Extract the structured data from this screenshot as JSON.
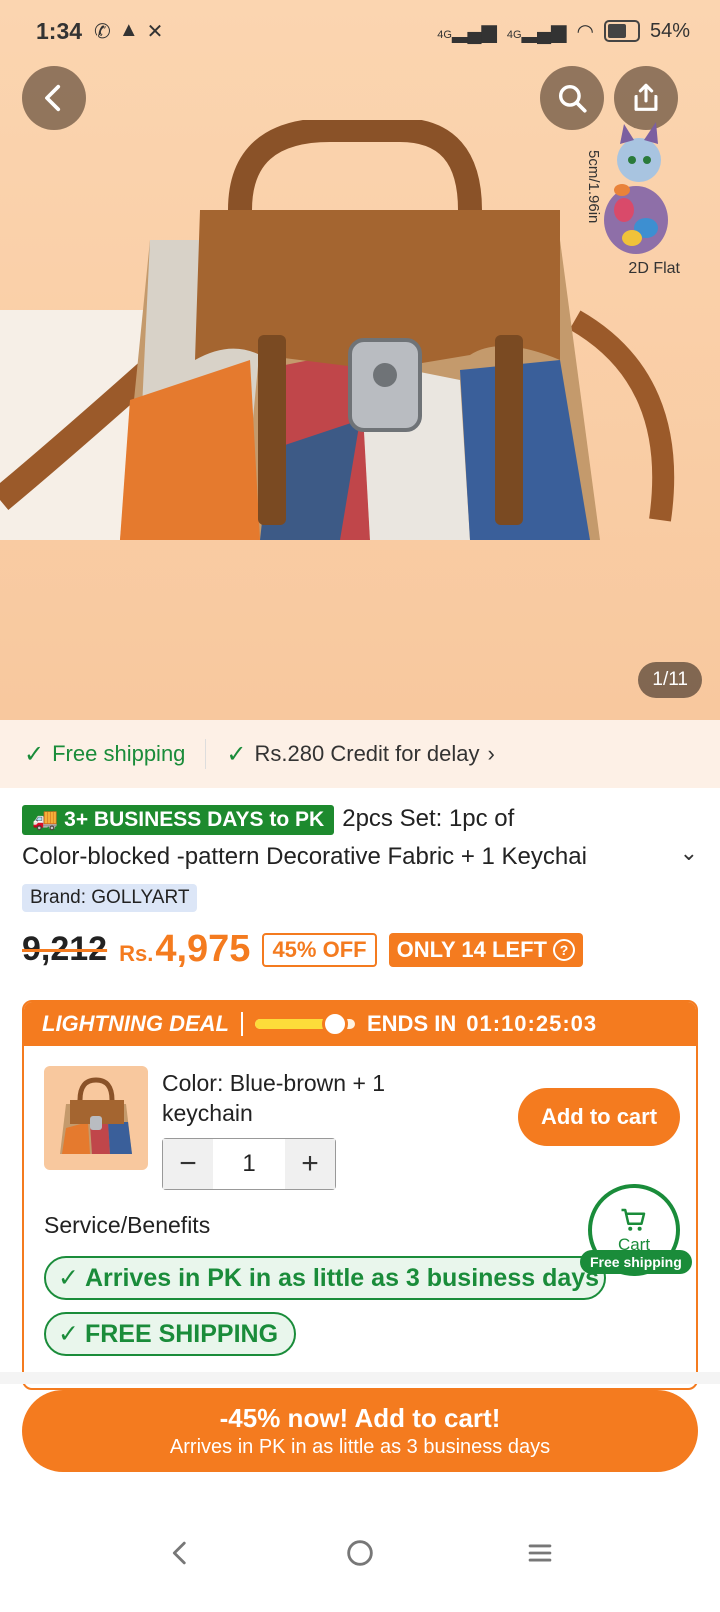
{
  "status_bar": {
    "time": "1:34",
    "battery": "54%",
    "network_1": "4G",
    "network_2": "4G"
  },
  "hero": {
    "image_counter": "1/11",
    "dimension_label": "5cm/1.96in",
    "flat_label": "2D Flat"
  },
  "shipping_strip": {
    "free_shipping": "Free shipping",
    "credit": "Rs.280 Credit for delay"
  },
  "product": {
    "delivery_badge": "3+ BUSINESS DAYS to PK",
    "title_line1": "2pcs Set: 1pc of",
    "title_line2": "Color-blocked -pattern Decorative Fabric + 1 Keychai",
    "brand": "Brand: GOLLYART"
  },
  "price": {
    "old": "9,212",
    "currency": "Rs.",
    "current": "4,975",
    "discount": "45% OFF",
    "stock": "ONLY 14 LEFT",
    "stock_info_icon": "?"
  },
  "deal": {
    "label": "LIGHTNING DEAL",
    "ends_label": "ENDS IN",
    "timer": "01:10:25:03",
    "progress": 0.8,
    "variant": "Color: Blue-brown + 1 keychain",
    "quantity": "1",
    "minus": "−",
    "plus": "+",
    "add_to_cart": "Add to cart",
    "service_title": "Service/Benefits",
    "benefit_1": "Arrives in PK in as little as 3 business days",
    "benefit_2": "FREE SHIPPING"
  },
  "cart_float": {
    "label": "Cart",
    "tag": "Free shipping"
  },
  "cta": {
    "line1": "-45% now! Add to cart!",
    "line2": "Arrives in PK in as little as 3 business days"
  },
  "colors": {
    "accent": "#f47b1f",
    "green": "#1a8c3a",
    "hero_bg": "#f8c89e"
  }
}
